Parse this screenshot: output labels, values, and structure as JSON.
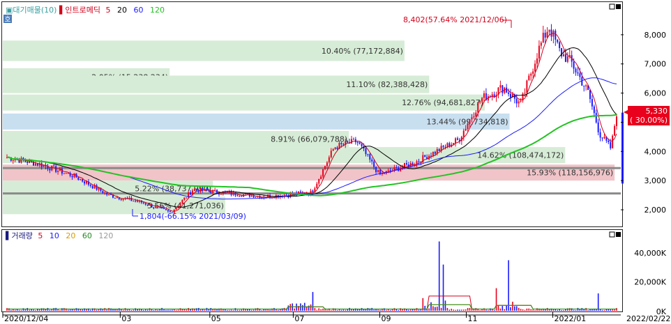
{
  "chart_data": {
    "type": "candlestick",
    "legend": {
      "price": {
        "prefix": "▣대기매물(10)",
        "stock": "▌인트로메딕",
        "ma": [
          {
            "label": "5",
            "color": "#d4001b"
          },
          {
            "label": "20",
            "color": "#000000"
          },
          {
            "label": "60",
            "color": "#1a1aff"
          },
          {
            "label": "120",
            "color": "#22c322"
          }
        ]
      },
      "volume": {
        "prefix": "▌거래량",
        "ma": [
          {
            "label": "5",
            "color": "#d4001b"
          },
          {
            "label": "10",
            "color": "#1a1aff"
          },
          {
            "label": "20",
            "color": "#d99a00"
          },
          {
            "label": "60",
            "color": "#228b22"
          },
          {
            "label": "120",
            "color": "#999999"
          }
        ]
      }
    },
    "price_axis": {
      "min": 1500,
      "max": 9000,
      "ticks": [
        "2,000",
        "3,000",
        "4,000",
        "5,000",
        "6,000",
        "7,000",
        "8,000"
      ]
    },
    "volume_axis": {
      "min": 0,
      "max": 55000,
      "ticks": [
        "0K",
        "20,000K",
        "40,000K"
      ]
    },
    "x_labels": [
      "2020/12/04",
      "03",
      "05",
      "07",
      "09",
      "11",
      "2022/01",
      "2022/02/22"
    ],
    "volume_profile": [
      {
        "label": "2.05% (15,238,234)",
        "low": 6250,
        "high": 6850,
        "width": 0.27
      },
      {
        "label": "10.40% (77,172,884)",
        "low": 7100,
        "high": 7800,
        "width": 0.65
      },
      {
        "label": "11.10% (82,388,428)",
        "low": 6000,
        "high": 6600,
        "width": 0.69
      },
      {
        "label": "12.76% (94,681,827)",
        "low": 5400,
        "high": 5950,
        "width": 0.78
      },
      {
        "label": "13.44% (99,734,818)",
        "low": 4750,
        "high": 5300,
        "width": 0.82,
        "highlight": "blue"
      },
      {
        "label": "8.91% (66,079,788)",
        "low": 4150,
        "high": 4700,
        "width": 0.56
      },
      {
        "label": "14.62% (108,474,172)",
        "low": 3600,
        "high": 4150,
        "width": 0.91
      },
      {
        "label": "15.93% (118,156,976)",
        "low": 3000,
        "high": 3550,
        "width": 0.99,
        "highlight": "red"
      },
      {
        "label": "5.22% (38,737,990)",
        "low": 2450,
        "high": 3000,
        "width": 0.34
      },
      {
        "label": "5.56% (41,271,036)",
        "low": 1850,
        "high": 2450,
        "width": 0.36
      }
    ],
    "support_lines": [
      3430,
      2560
    ],
    "annotations": {
      "high": "8,402(57.64% 2021/12/06)",
      "low": "1,804(-66.15% 2021/03/09)"
    },
    "current": {
      "price": "5,330",
      "change": "( 30.00%)",
      "value": 5330
    },
    "series_key_points": {
      "close": [
        [
          0,
          3800
        ],
        [
          0.06,
          3550
        ],
        [
          0.12,
          3150
        ],
        [
          0.18,
          2500
        ],
        [
          0.24,
          2250
        ],
        [
          0.29,
          1900
        ],
        [
          0.33,
          2700
        ],
        [
          0.4,
          2550
        ],
        [
          0.46,
          2450
        ],
        [
          0.54,
          2600
        ],
        [
          0.58,
          4150
        ],
        [
          0.62,
          4350
        ],
        [
          0.66,
          3200
        ],
        [
          0.72,
          3600
        ],
        [
          0.8,
          4400
        ],
        [
          0.84,
          5800
        ],
        [
          0.88,
          6200
        ],
        [
          0.91,
          5600
        ],
        [
          0.94,
          7400
        ],
        [
          0.96,
          8300
        ],
        [
          0.98,
          7400
        ],
        [
          1.0,
          7050
        ],
        [
          1.03,
          6000
        ],
        [
          1.05,
          4600
        ],
        [
          1.07,
          4100
        ],
        [
          1.08,
          5330
        ]
      ]
    }
  }
}
